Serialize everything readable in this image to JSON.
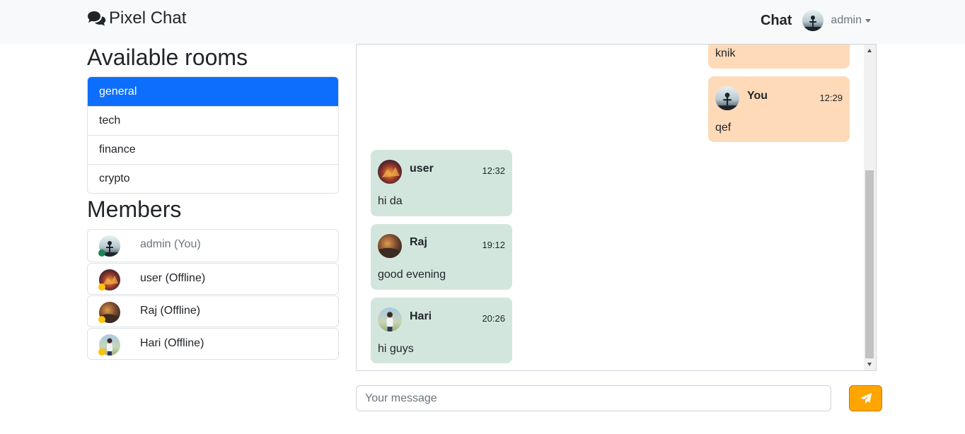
{
  "navbar": {
    "brand": "Pixel Chat",
    "chat_link": "Chat",
    "user_menu": "admin"
  },
  "rooms": {
    "title": "Available rooms",
    "items": [
      {
        "label": "general",
        "active": true
      },
      {
        "label": "tech"
      },
      {
        "label": "finance"
      },
      {
        "label": "crypto"
      }
    ]
  },
  "members": {
    "title": "Members",
    "items": [
      {
        "label": "admin (You)",
        "status": "online",
        "status_color": "#198754"
      },
      {
        "label": "user (Offline)",
        "status": "offline",
        "status_color": "#ffc107"
      },
      {
        "label": "Raj (Offline)",
        "status": "offline",
        "status_color": "#ffc107"
      },
      {
        "label": "Hari (Offline)",
        "status": "offline",
        "status_color": "#ffc107"
      }
    ]
  },
  "messages": [
    {
      "sender": "",
      "time": "",
      "text": "knik",
      "mine": true
    },
    {
      "sender": "You",
      "time": "12:29",
      "text": "qef",
      "mine": true
    },
    {
      "sender": "user",
      "time": "12:32",
      "text": "hi da",
      "mine": false
    },
    {
      "sender": "Raj",
      "time": "19:12",
      "text": "good evening",
      "mine": false
    },
    {
      "sender": "Hari",
      "time": "20:26",
      "text": "hi guys",
      "mine": false
    }
  ],
  "composer": {
    "placeholder": "Your message",
    "send_icon": "paper-plane-icon"
  },
  "colors": {
    "primary": "#0d6efd",
    "my_bubble": "#ffdab9",
    "their_bubble": "#d3e6de",
    "send_button": "#ffa500"
  }
}
